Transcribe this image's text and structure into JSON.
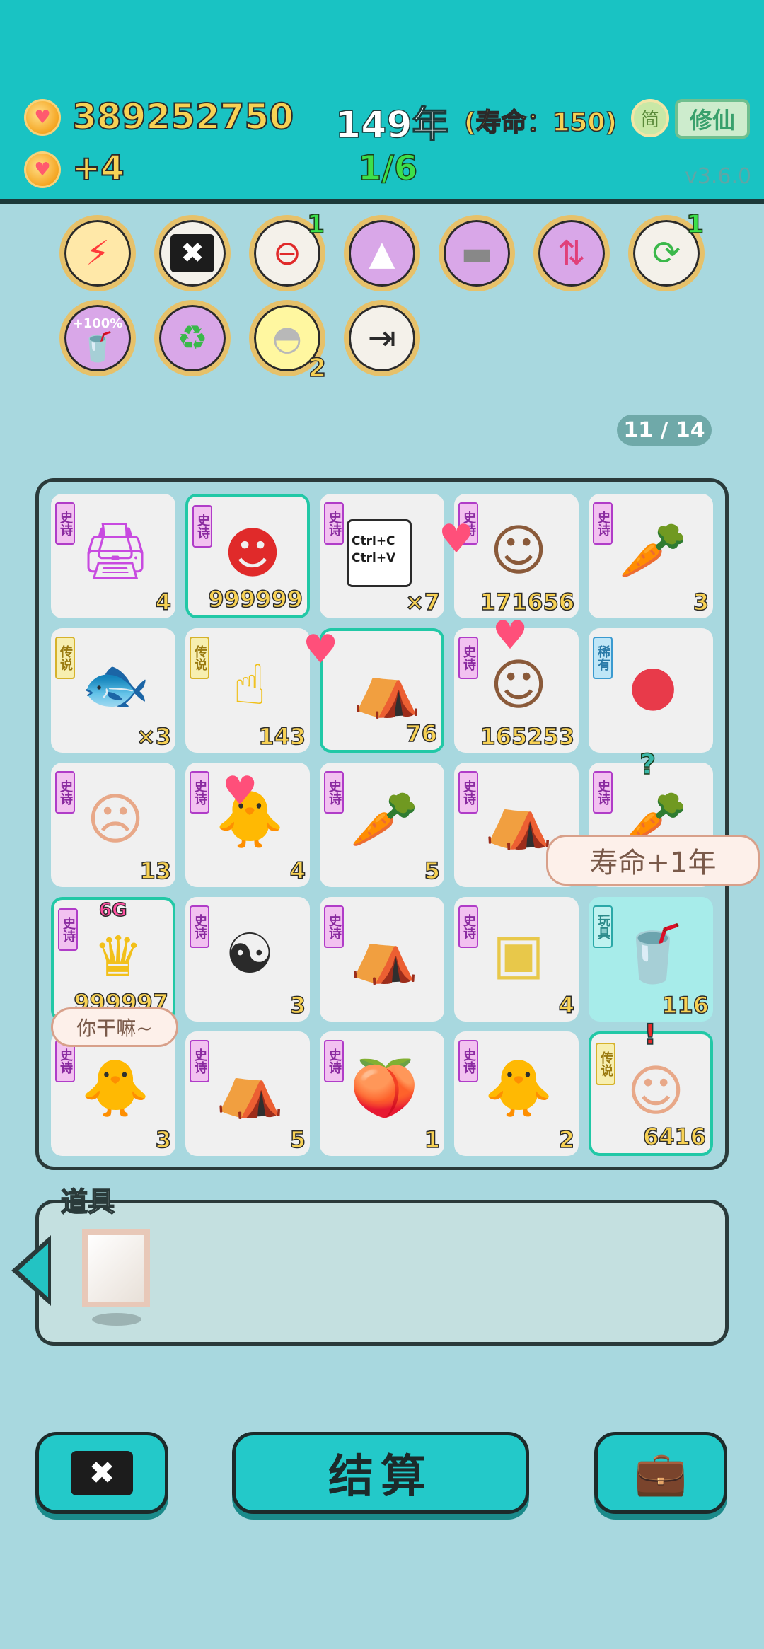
{
  "header": {
    "coins": "389252750",
    "coin_delta": "+4",
    "year": "149年",
    "lifespan": "(寿命：150)",
    "progress": "1/6",
    "simplified_label": "简",
    "cultivate_label": "修仙",
    "version": "v3.6.0"
  },
  "skills": [
    {
      "icon": "lightning-icon",
      "badge": ""
    },
    {
      "icon": "delete-tag-icon",
      "badge": ""
    },
    {
      "icon": "minus-circle-icon",
      "badge": "1"
    },
    {
      "icon": "skirt-icon",
      "badge": ""
    },
    {
      "icon": "cleaver-icon",
      "badge": ""
    },
    {
      "icon": "bowls-arrow-icon",
      "badge": ""
    },
    {
      "icon": "refresh-icon",
      "badge": "1"
    },
    {
      "icon": "tea-100-icon",
      "badge": "",
      "label": "+100%"
    },
    {
      "icon": "recycle-icon",
      "badge": ""
    },
    {
      "icon": "shell-icon",
      "badge": "2"
    },
    {
      "icon": "skip-icon",
      "badge": ""
    }
  ],
  "page_counter": "11 / 14",
  "board": {
    "rows": [
      [
        {
          "tag": "史诗",
          "item": "printer",
          "count": "4"
        },
        {
          "tag": "史诗",
          "item": "red-hat-boy",
          "count": "999999"
        },
        {
          "tag": "史诗",
          "item": "copy-paste",
          "count": "×7",
          "text": "Ctrl+C\nCtrl+V"
        },
        {
          "tag": "史诗",
          "item": "girl",
          "count": "171656"
        },
        {
          "tag": "史诗",
          "item": "carrot",
          "count": "3"
        }
      ],
      [
        {
          "tag": "传说",
          "item": "koi-fish",
          "count": "×3"
        },
        {
          "tag": "传说",
          "item": "pointing-hand",
          "count": "143"
        },
        {
          "tag": "",
          "item": "rabbit-tent",
          "count": "76"
        },
        {
          "tag": "史诗",
          "item": "girl",
          "count": "165253"
        },
        {
          "tag": "稀有",
          "item": "lychee",
          "count": ""
        }
      ],
      [
        {
          "tag": "史诗",
          "item": "bald-man",
          "count": "13"
        },
        {
          "tag": "史诗",
          "item": "bird-grandma",
          "count": "4"
        },
        {
          "tag": "史诗",
          "item": "carrot",
          "count": "5"
        },
        {
          "tag": "史诗",
          "item": "rabbit-tent",
          "count": ""
        },
        {
          "tag": "史诗",
          "item": "carrot",
          "count": ""
        }
      ],
      [
        {
          "tag": "史诗",
          "item": "king-6g",
          "count": "999997",
          "label": "6G"
        },
        {
          "tag": "史诗",
          "item": "bagua",
          "count": "3"
        },
        {
          "tag": "史诗",
          "item": "rabbit-tent",
          "count": ""
        },
        {
          "tag": "史诗",
          "item": "claw-machine",
          "count": "4"
        },
        {
          "tag": "玩具",
          "item": "tea-cup",
          "count": "116"
        }
      ],
      [
        {
          "tag": "史诗",
          "item": "bird-grandma",
          "count": "3"
        },
        {
          "tag": "史诗",
          "item": "rabbit-tent",
          "count": "5"
        },
        {
          "tag": "史诗",
          "item": "peach",
          "count": "1"
        },
        {
          "tag": "史诗",
          "item": "bird-grandma",
          "count": "2"
        },
        {
          "tag": "传说",
          "item": "old-man-glasses",
          "count": "6416"
        }
      ]
    ]
  },
  "bubbles": {
    "lifespan_bonus": "寿命+1年",
    "what_doing": "你干嘛~",
    "question_mark": "?",
    "exclaim": "!"
  },
  "props": {
    "title": "道具"
  },
  "bottom": {
    "settle_label": "结算"
  },
  "colors": {
    "top_bar": "#19c3c3",
    "background": "#a8d8df",
    "accent_yellow": "#f7d154",
    "accent_green": "#3ce04a"
  }
}
